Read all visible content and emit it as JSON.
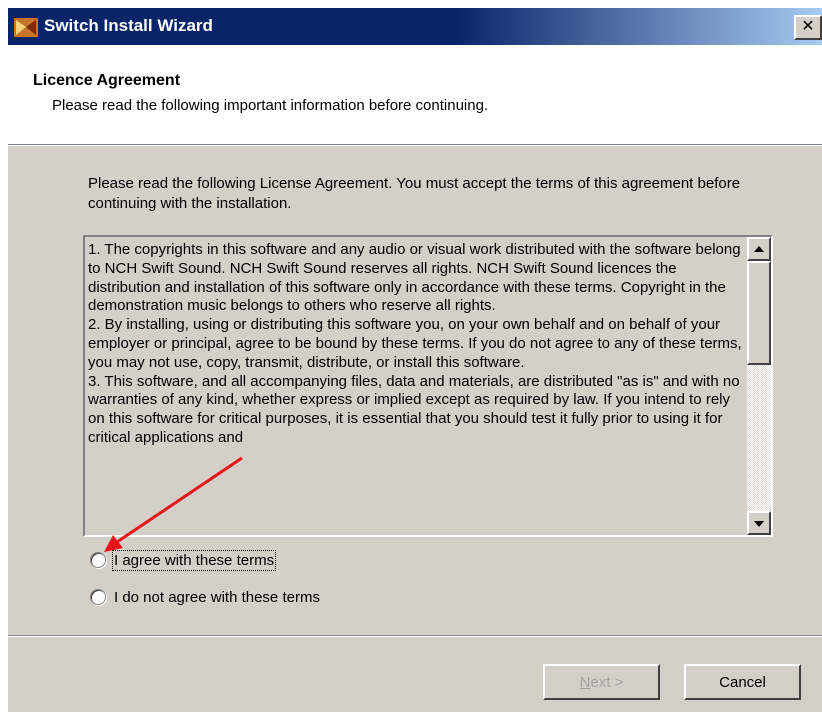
{
  "window": {
    "title": "Switch Install Wizard",
    "close_glyph": "✕"
  },
  "header": {
    "title": "Licence Agreement",
    "subtitle": "Please read the following important information before continuing."
  },
  "intro": "Please read the following License Agreement. You must accept the terms of this agreement before continuing with the installation.",
  "license_text": "1. The copyrights in this software and any audio or visual work distributed with the software belong to NCH Swift Sound. NCH Swift Sound reserves all rights. NCH Swift Sound licences the distribution and installation of this software only in accordance with these terms. Copyright in the demonstration music belongs to others who reserve all rights.\n2. By installing, using or distributing this software you, on your own behalf and on behalf of your employer or principal, agree to be bound by these terms. If you do not agree to any of these terms, you may not use, copy, transmit, distribute, or install this software.\n3. This software, and all accompanying files, data and materials, are distributed \"as is\" and with no warranties of any kind, whether express or implied except as required by law. If you intend to rely on this software for critical purposes, it is essential that you should test it fully prior to using it for critical applications and",
  "radios": [
    {
      "label": "I agree with these terms",
      "checked": false
    },
    {
      "label": "I do not agree with these terms",
      "checked": false
    }
  ],
  "buttons": {
    "next_hotkey": "N",
    "next_rest": "ext >",
    "cancel": "Cancel"
  },
  "colors": {
    "titlebar": "#0a246a",
    "dialog_bg": "#d4d0c8",
    "annotation_arrow": "#e8141a"
  }
}
